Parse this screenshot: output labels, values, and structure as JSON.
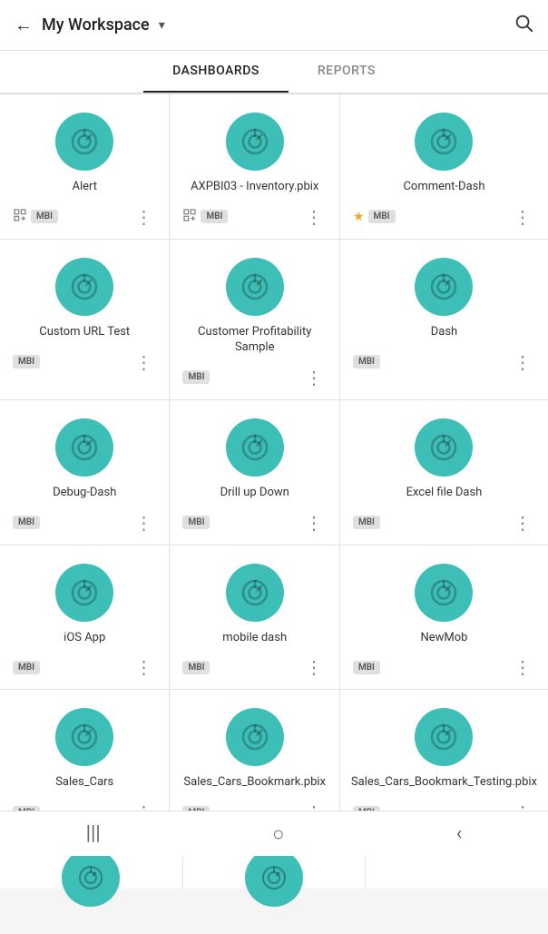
{
  "header": {
    "title": "My Workspace",
    "chevron": "▾",
    "back_label": "←",
    "search_label": "🔍"
  },
  "tabs": [
    {
      "id": "dashboards",
      "label": "DASHBOARDS",
      "active": true
    },
    {
      "id": "reports",
      "label": "REPORTS",
      "active": false
    }
  ],
  "dashboards": [
    {
      "id": 1,
      "name": "Alert",
      "badge": "MBI",
      "shared": true,
      "starred": false
    },
    {
      "id": 2,
      "name": "AXPBI03 - Inventory.pbix",
      "badge": "MBI",
      "shared": true,
      "starred": false
    },
    {
      "id": 3,
      "name": "Comment-Dash",
      "badge": "MBI",
      "shared": false,
      "starred": true
    },
    {
      "id": 4,
      "name": "Custom URL Test",
      "badge": "MBI",
      "shared": false,
      "starred": false
    },
    {
      "id": 5,
      "name": "Customer Profitability Sample",
      "badge": "MBI",
      "shared": false,
      "starred": false
    },
    {
      "id": 6,
      "name": "Dash",
      "badge": "MBI",
      "shared": false,
      "starred": false
    },
    {
      "id": 7,
      "name": "Debug-Dash",
      "badge": "MBI",
      "shared": false,
      "starred": false
    },
    {
      "id": 8,
      "name": "Drill up Down",
      "badge": "MBI",
      "shared": false,
      "starred": false
    },
    {
      "id": 9,
      "name": "Excel file Dash",
      "badge": "MBI",
      "shared": false,
      "starred": false
    },
    {
      "id": 10,
      "name": "iOS App",
      "badge": "MBI",
      "shared": false,
      "starred": false
    },
    {
      "id": 11,
      "name": "mobile dash",
      "badge": "MBI",
      "shared": false,
      "starred": false
    },
    {
      "id": 12,
      "name": "NewMob",
      "badge": "MBI",
      "shared": false,
      "starred": false
    },
    {
      "id": 13,
      "name": "Sales_Cars",
      "badge": "MBI",
      "shared": false,
      "starred": false
    },
    {
      "id": 14,
      "name": "Sales_Cars_Bookmark.pbix",
      "badge": "MBI",
      "shared": false,
      "starred": false
    },
    {
      "id": 15,
      "name": "Sales_Cars_Bookmark_Testing.pbix",
      "badge": "MBI",
      "shared": false,
      "starred": false
    }
  ],
  "bottom_nav": {
    "menu_icon": "|||",
    "home_icon": "○",
    "back_icon": "‹"
  }
}
